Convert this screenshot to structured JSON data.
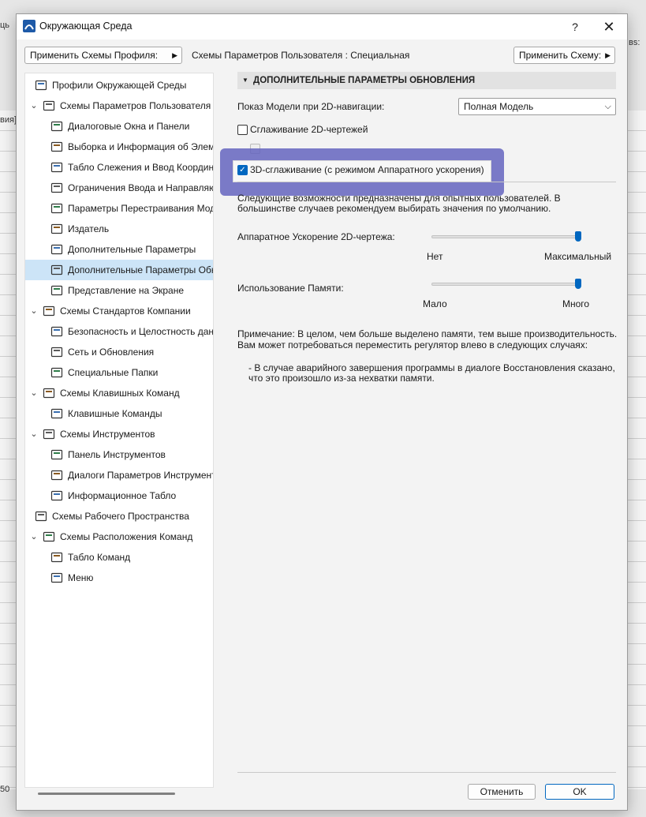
{
  "background": {
    "top_left_fragment": "ць",
    "left_fragment": "вия]",
    "bottom_left_fragment": "50",
    "top_right_fragment": "вs:"
  },
  "dialog": {
    "title": "Окружающая Среда",
    "help": "?",
    "close": "✕"
  },
  "toolbar": {
    "apply_profile": "Применить Схемы Профиля:",
    "schemes_label": "Схемы Параметров Пользователя : Специальная",
    "apply_scheme": "Применить Схему:"
  },
  "tree": [
    {
      "label": "Профили Окружающей Среды",
      "icon": "profiles-icon",
      "level": 0,
      "expandable": false,
      "selected": false
    },
    {
      "label": "Схемы Параметров Пользователя",
      "icon": "user-schemes-icon",
      "level": 0,
      "expandable": true,
      "selected": false
    },
    {
      "label": "Диалоговые Окна и Панели",
      "icon": "dialogs-icon",
      "level": 1,
      "expandable": false,
      "selected": false
    },
    {
      "label": "Выборка и Информация об Элеме",
      "icon": "selection-icon",
      "level": 1,
      "expandable": false,
      "selected": false
    },
    {
      "label": "Табло Слежения и Ввод Координат",
      "icon": "xyz-icon",
      "level": 1,
      "expandable": false,
      "selected": false
    },
    {
      "label": "Ограничения Ввода и Направляю",
      "icon": "mouse-icon",
      "level": 1,
      "expandable": false,
      "selected": false
    },
    {
      "label": "Параметры Перестраивания Моде",
      "icon": "rebuild-icon",
      "level": 1,
      "expandable": false,
      "selected": false
    },
    {
      "label": "Издатель",
      "icon": "publisher-icon",
      "level": 1,
      "expandable": false,
      "selected": false
    },
    {
      "label": "Дополнительные Параметры",
      "icon": "sliders-icon",
      "level": 1,
      "expandable": false,
      "selected": false
    },
    {
      "label": "Дополнительные Параметры Обно",
      "icon": "update-settings-icon",
      "level": 1,
      "expandable": false,
      "selected": true
    },
    {
      "label": "Представление на Экране",
      "icon": "screen-icon",
      "level": 1,
      "expandable": false,
      "selected": false
    },
    {
      "label": "Схемы Стандартов Компании",
      "icon": "company-schemes-icon",
      "level": 0,
      "expandable": true,
      "selected": false
    },
    {
      "label": "Безопасность и Целостность данн",
      "icon": "security-icon",
      "level": 1,
      "expandable": false,
      "selected": false
    },
    {
      "label": "Сеть и Обновления",
      "icon": "globe-icon",
      "level": 1,
      "expandable": false,
      "selected": false
    },
    {
      "label": "Специальные Папки",
      "icon": "folder-icon",
      "level": 1,
      "expandable": false,
      "selected": false
    },
    {
      "label": "Схемы Клавишных Команд",
      "icon": "shortcut-schemes-icon",
      "level": 0,
      "expandable": true,
      "selected": false
    },
    {
      "label": "Клавишные Команды",
      "icon": "shortcut-icon",
      "level": 1,
      "expandable": false,
      "selected": false
    },
    {
      "label": "Схемы Инструментов",
      "icon": "tool-schemes-icon",
      "level": 0,
      "expandable": true,
      "selected": false
    },
    {
      "label": "Панель Инструментов",
      "icon": "toolbox-icon",
      "level": 1,
      "expandable": false,
      "selected": false
    },
    {
      "label": "Диалоги Параметров Инструменто",
      "icon": "tool-dialogs-icon",
      "level": 1,
      "expandable": false,
      "selected": false
    },
    {
      "label": "Информационное Табло",
      "icon": "info-box-icon",
      "level": 1,
      "expandable": false,
      "selected": false
    },
    {
      "label": "Схемы Рабочего Пространства",
      "icon": "workspace-schemes-icon",
      "level": 0,
      "expandable": false,
      "selected": false
    },
    {
      "label": "Схемы Расположения Команд",
      "icon": "command-layout-icon",
      "level": 0,
      "expandable": true,
      "selected": false
    },
    {
      "label": "Табло Команд",
      "icon": "command-box-icon",
      "level": 1,
      "expandable": false,
      "selected": false
    },
    {
      "label": "Меню",
      "icon": "menu-icon",
      "level": 1,
      "expandable": false,
      "selected": false
    }
  ],
  "panel": {
    "header": "ДОПОЛНИТЕЛЬНЫЕ ПАРАМЕТРЫ ОБНОВЛЕНИЯ",
    "model_display_label": "Показ Модели при 2D-навигации:",
    "model_display_value": "Полная Модель",
    "smoothing_2d_label": "Сглаживание 2D-чертежей",
    "smoothing_2d_checked": false,
    "hidden_option_checked": false,
    "smoothing_3d_label": "3D-сглаживание (с режимом Аппаратного ускорения)",
    "smoothing_3d_checked": true,
    "advanced_note": "Следующие возможности предназначены для опытных пользователей. В большинстве случаев рекомендуем выбирать значения по умолчанию.",
    "hw_accel_label": "Аппаратное Ускорение 2D-чертежа:",
    "hw_accel_min": "Нет",
    "hw_accel_max": "Максимальный",
    "hw_accel_value": 1.0,
    "memory_label": "Использование Памяти:",
    "memory_min": "Мало",
    "memory_max": "Много",
    "memory_value": 1.0,
    "note_line1": "Примечание: В целом, чем больше выделено памяти, тем выше производительность.",
    "note_line2": "Вам может потребоваться переместить регулятор влево в следующих случаях:",
    "bullet_line1": "- В случае аварийного завершения программы в диалоге Восстановления сказано,",
    "bullet_line2": "что это произошло из-за нехватки памяти."
  },
  "footer": {
    "cancel": "Отменить",
    "ok": "OK"
  },
  "colors": {
    "accent": "#0067c0",
    "selection": "#cce4f7",
    "highlight": "#6464be"
  }
}
